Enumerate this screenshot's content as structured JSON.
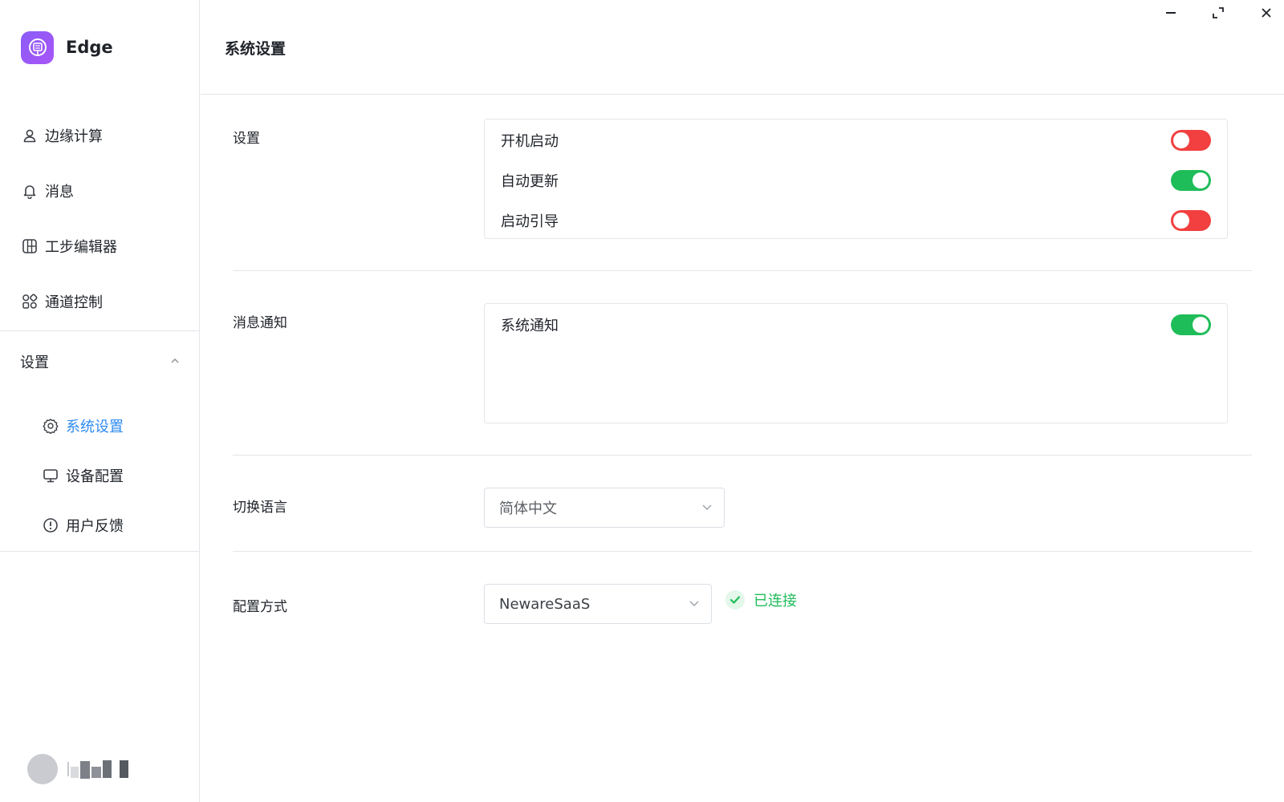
{
  "app": {
    "name": "Edge"
  },
  "sidebar": {
    "items": [
      {
        "label": "边缘计算",
        "icon": "user-icon"
      },
      {
        "label": "消息",
        "icon": "bell-icon"
      },
      {
        "label": "工步编辑器",
        "icon": "grid-icon"
      },
      {
        "label": "通道控制",
        "icon": "apps-icon"
      }
    ],
    "group": {
      "label": "设置",
      "expanded": true,
      "children": [
        {
          "label": "系统设置",
          "icon": "gear-icon",
          "active": true
        },
        {
          "label": "设备配置",
          "icon": "monitor-icon",
          "active": false
        },
        {
          "label": "用户反馈",
          "icon": "alert-circle-icon",
          "active": false
        }
      ]
    }
  },
  "header": {
    "title": "系统设置"
  },
  "sections": {
    "settings": {
      "label": "设置",
      "rows": [
        {
          "label": "开机启动",
          "enabled": false
        },
        {
          "label": "自动更新",
          "enabled": true
        },
        {
          "label": "启动引导",
          "enabled": false
        }
      ]
    },
    "notifications": {
      "label": "消息通知",
      "rows": [
        {
          "label": "系统通知",
          "enabled": true
        }
      ]
    },
    "language": {
      "label": "切换语言",
      "selected": "简体中文"
    },
    "config": {
      "label": "配置方式",
      "selected": "NewareSaaS",
      "status": "已连接"
    }
  },
  "colors": {
    "accent": "#2e8bf0",
    "toggle_on": "#1fbd59",
    "toggle_off": "#f23f3f",
    "brand": "#8b5cf6"
  }
}
